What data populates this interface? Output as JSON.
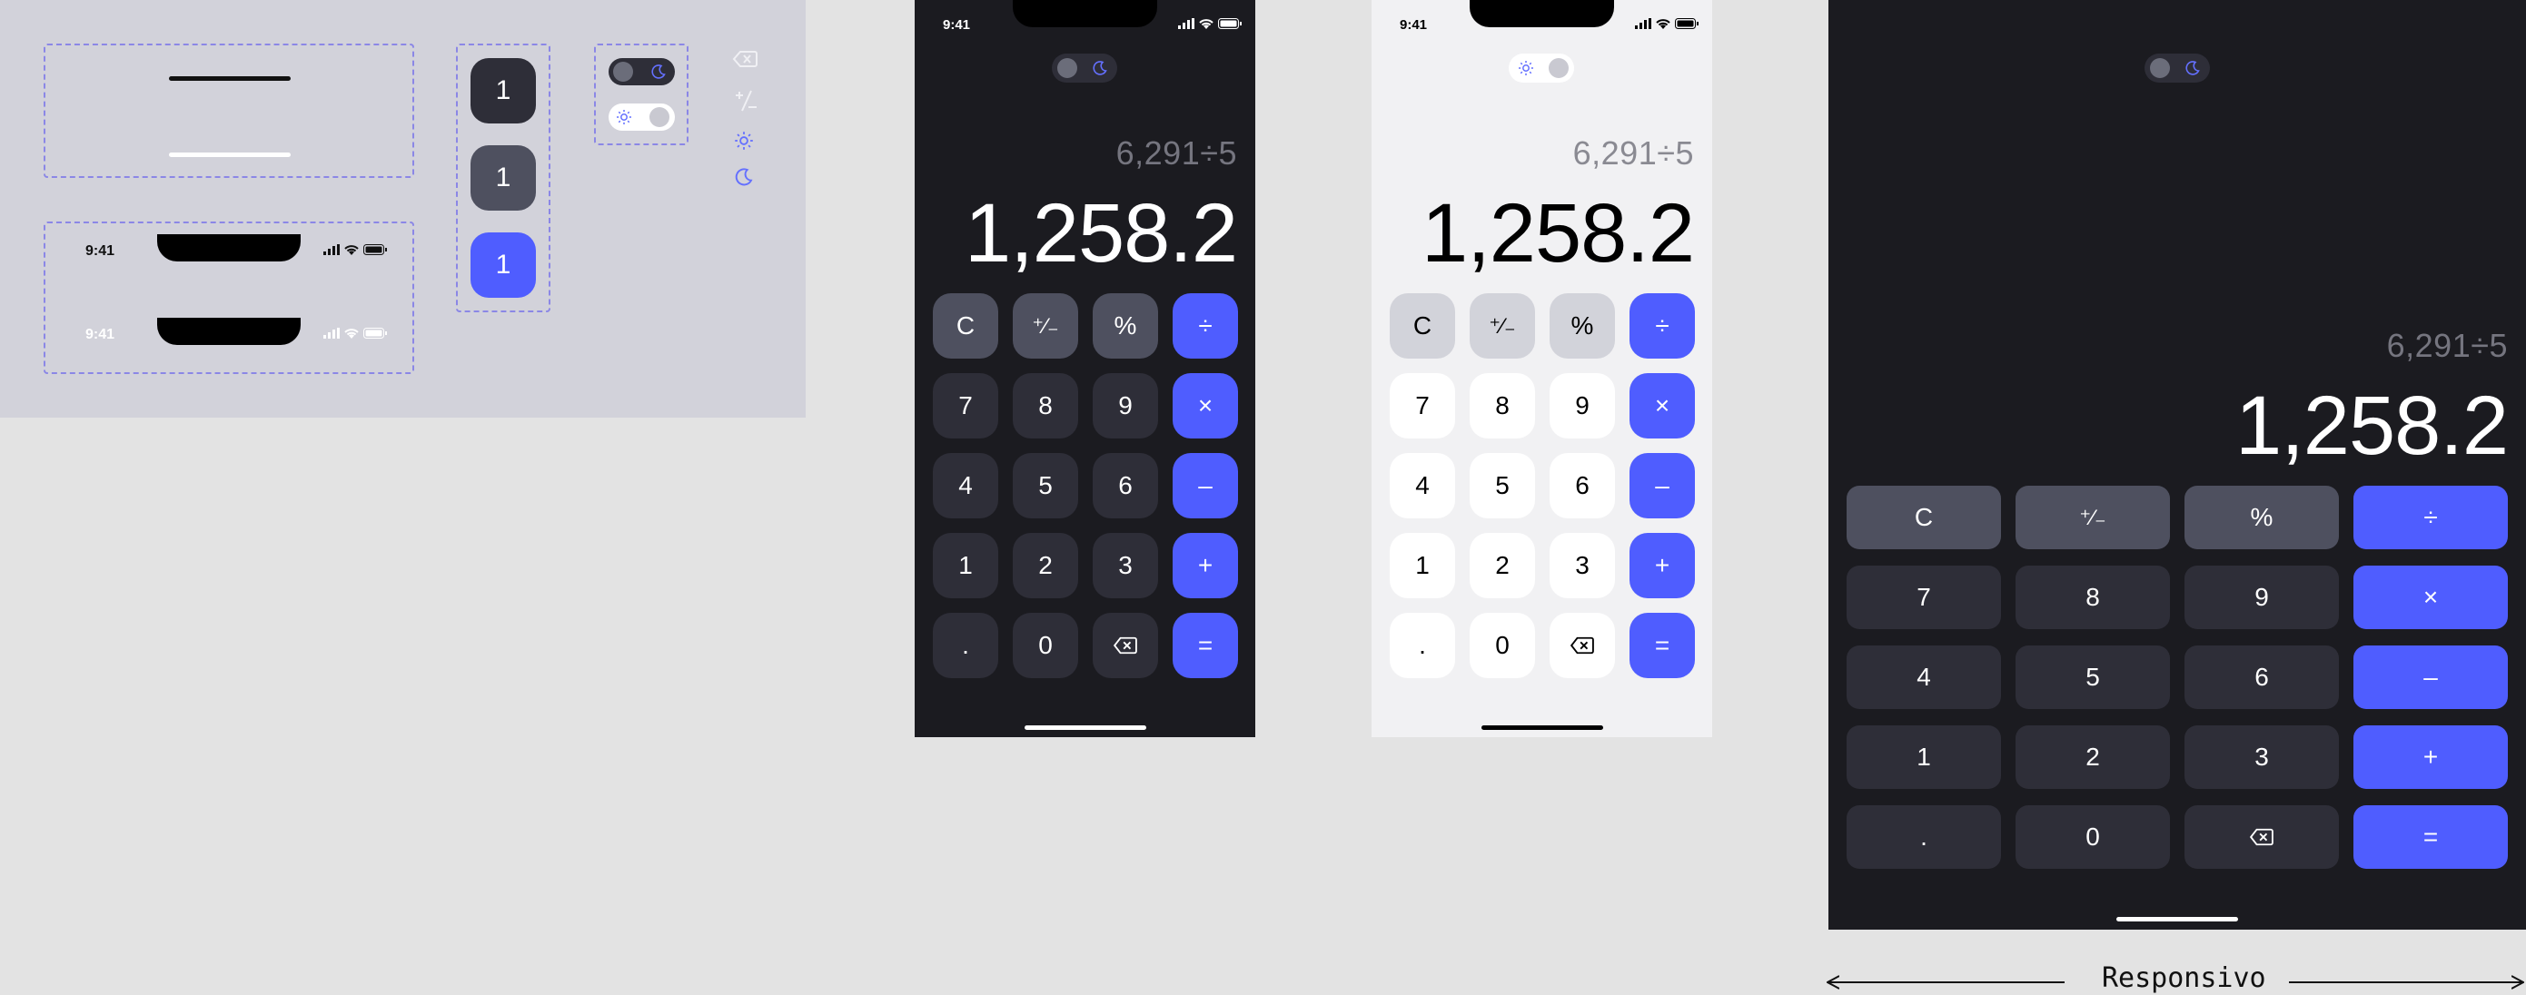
{
  "colors": {
    "accent": "#4f5dff",
    "dark_bg": "#1b1b20",
    "dark_key": "#2e2e38",
    "dark_func_key": "#4e505f",
    "light_bg": "#f1f1f3",
    "light_key": "#ffffff",
    "light_func_key": "#d2d3da"
  },
  "components": {
    "status_time": "9:41",
    "key_sample": "1"
  },
  "status": {
    "time": "9:41"
  },
  "display": {
    "expression": "6,291÷5",
    "result": "1,258.2"
  },
  "keypad": [
    [
      "C",
      "⁺∕₋",
      "%",
      "÷"
    ],
    [
      "7",
      "8",
      "9",
      "×"
    ],
    [
      "4",
      "5",
      "6",
      "–"
    ],
    [
      "1",
      "2",
      "3",
      "+"
    ],
    [
      ".",
      "0",
      "backspace-icon",
      "="
    ]
  ],
  "key_kinds": [
    [
      "func",
      "func",
      "func",
      "op"
    ],
    [
      "num",
      "num",
      "num",
      "op"
    ],
    [
      "num",
      "num",
      "num",
      "op"
    ],
    [
      "num",
      "num",
      "num",
      "op"
    ],
    [
      "num",
      "num",
      "num",
      "op"
    ]
  ],
  "responsive_label": "Responsivo"
}
